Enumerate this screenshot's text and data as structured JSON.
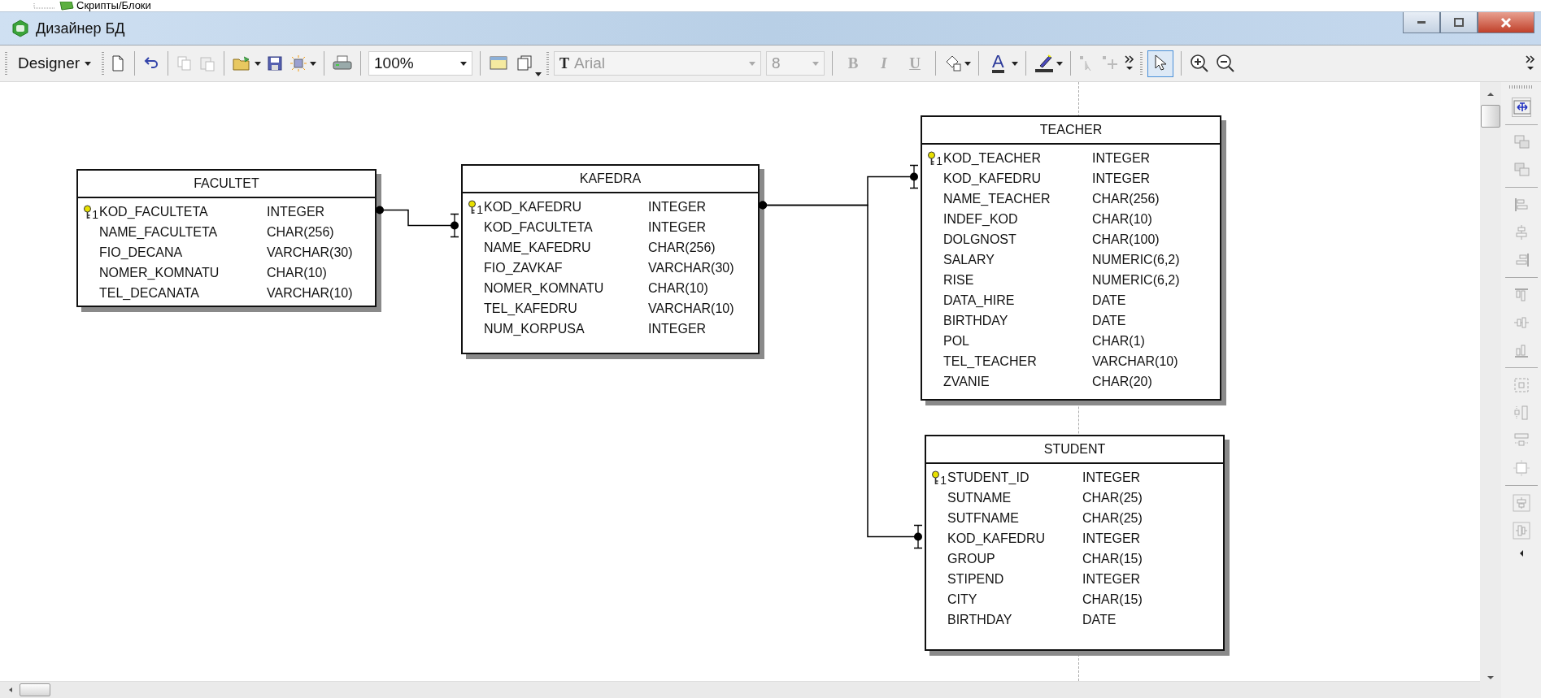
{
  "top_strip": {
    "tree_item": "Скрипты/Блоки"
  },
  "window": {
    "title": "Дизайнер БД"
  },
  "toolbar": {
    "designer_menu": "Designer",
    "zoom": "100%",
    "font_glyph": "T",
    "font": {
      "value": "Arial",
      "disabled": true
    },
    "font_size": {
      "value": "8",
      "disabled": true
    },
    "format_buttons": [
      {
        "label": "B",
        "disabled": true
      },
      {
        "label": "I",
        "disabled": true
      },
      {
        "label": "U",
        "disabled": true
      }
    ],
    "font_color_glyph": "A",
    "pointer_selected": true
  },
  "tables": [
    {
      "name": "FACULTET",
      "columns": [
        {
          "name": "KOD_FACULTETA",
          "type": "INTEGER",
          "kind": "primary",
          "key_label": "1"
        },
        {
          "name": "NAME_FACULTETA",
          "type": "CHAR(256)",
          "kind": "plain"
        },
        {
          "name": "FIO_DECANA",
          "type": "VARCHAR(30)",
          "kind": "plain"
        },
        {
          "name": "NOMER_KOMNATU",
          "type": "CHAR(10)",
          "kind": "plain"
        },
        {
          "name": "TEL_DECANATA",
          "type": "VARCHAR(10)",
          "kind": "plain"
        }
      ]
    },
    {
      "name": "KAFEDRA",
      "columns": [
        {
          "name": "KOD_KAFEDRU",
          "type": "INTEGER",
          "kind": "primary",
          "key_label": "1"
        },
        {
          "name": "KOD_FACULTETA",
          "type": "INTEGER",
          "kind": "foreign"
        },
        {
          "name": "NAME_KAFEDRU",
          "type": "CHAR(256)",
          "kind": "plain"
        },
        {
          "name": "FIO_ZAVKAF",
          "type": "VARCHAR(30)",
          "kind": "plain"
        },
        {
          "name": "NOMER_KOMNATU",
          "type": "CHAR(10)",
          "kind": "plain"
        },
        {
          "name": "TEL_KAFEDRU",
          "type": "VARCHAR(10)",
          "kind": "plain"
        },
        {
          "name": "NUM_KORPUSA",
          "type": "INTEGER",
          "kind": "plain"
        }
      ]
    },
    {
      "name": "TEACHER",
      "columns": [
        {
          "name": "KOD_TEACHER",
          "type": "INTEGER",
          "kind": "primary",
          "key_label": "1"
        },
        {
          "name": "KOD_KAFEDRU",
          "type": "INTEGER",
          "kind": "foreign"
        },
        {
          "name": "NAME_TEACHER",
          "type": "CHAR(256)",
          "kind": "plain"
        },
        {
          "name": "INDEF_KOD",
          "type": "CHAR(10)",
          "kind": "plain"
        },
        {
          "name": "DOLGNOST",
          "type": "CHAR(100)",
          "kind": "plain"
        },
        {
          "name": "SALARY",
          "type": "NUMERIC(6,2)",
          "kind": "plain"
        },
        {
          "name": "RISE",
          "type": "NUMERIC(6,2)",
          "kind": "plain"
        },
        {
          "name": "DATA_HIRE",
          "type": "DATE",
          "kind": "plain"
        },
        {
          "name": "BIRTHDAY",
          "type": "DATE",
          "kind": "plain"
        },
        {
          "name": "POL",
          "type": "CHAR(1)",
          "kind": "plain"
        },
        {
          "name": "TEL_TEACHER",
          "type": "VARCHAR(10)",
          "kind": "plain"
        },
        {
          "name": "ZVANIE",
          "type": "CHAR(20)",
          "kind": "plain"
        }
      ]
    },
    {
      "name": "STUDENT",
      "columns": [
        {
          "name": "STUDENT_ID",
          "type": "INTEGER",
          "kind": "primary",
          "key_label": "1"
        },
        {
          "name": "SUTNAME",
          "type": "CHAR(25)",
          "kind": "plain"
        },
        {
          "name": "SUTFNAME",
          "type": "CHAR(25)",
          "kind": "plain"
        },
        {
          "name": "KOD_KAFEDRU",
          "type": "INTEGER",
          "kind": "foreign"
        },
        {
          "name": "GROUP",
          "type": "CHAR(15)",
          "kind": "plain"
        },
        {
          "name": "STIPEND",
          "type": "INTEGER",
          "kind": "plain"
        },
        {
          "name": "CITY",
          "type": "CHAR(15)",
          "kind": "plain"
        },
        {
          "name": "BIRTHDAY",
          "type": "DATE",
          "kind": "plain"
        }
      ]
    }
  ]
}
